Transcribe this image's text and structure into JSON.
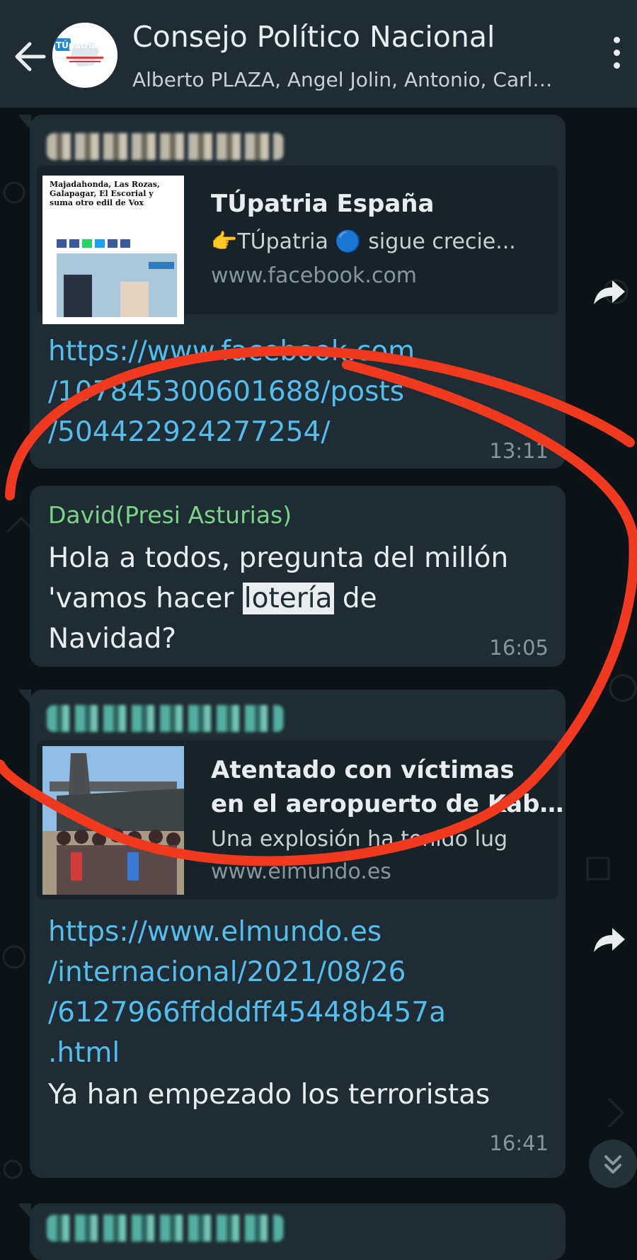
{
  "header": {
    "title": "Consejo Político Nacional",
    "subtitle": "Alberto PLAZA, Angel Jolin, Antonio, Carl…",
    "avatar_text": "TÚpatria"
  },
  "messages": [
    {
      "preview": {
        "thumb_text": "Majadahonda, Las Rozas, Galapagar, El Escorial y suma otro edil de Vox",
        "title": "TÚpatria España",
        "description": "👉TÚpatria 🔵 sigue crecie...",
        "site": "www.facebook.com"
      },
      "link_lines": [
        "https://www.facebook.com",
        "/107845300601688/posts",
        "/504422924277254/"
      ],
      "time": "13:11"
    },
    {
      "sender": "David(Presi Asturias)",
      "text_line1": "Hola a todos, pregunta del millón",
      "text_line2_a": "'vamos hacer ",
      "text_line2_hl": "lotería",
      "text_line2_b": " de",
      "text_line3": "Navidad?",
      "time": "16:05"
    },
    {
      "preview": {
        "title_line1": "Atentado con víctimas",
        "title_line2": "en el aeropuerto de Kab…",
        "description": "Una explosión ha tenido lug",
        "site": "www.elmundo.es"
      },
      "link_lines": [
        "https://www.elmundo.es",
        "/internacional/2021/08/26",
        "/6127966ffdddff45448b457a",
        ".html"
      ],
      "text": "Ya han empezado los terroristas",
      "time": "16:41"
    }
  ],
  "colors": {
    "header_bg": "#1f2c34",
    "bubble_bg": "#1f2c34",
    "link": "#53bdeb",
    "sender_name": "#7bd389",
    "annotation_red": "#f0391e"
  },
  "icons": [
    "back-arrow-icon",
    "more-vert-icon",
    "forward-icon",
    "scroll-down-icon"
  ]
}
